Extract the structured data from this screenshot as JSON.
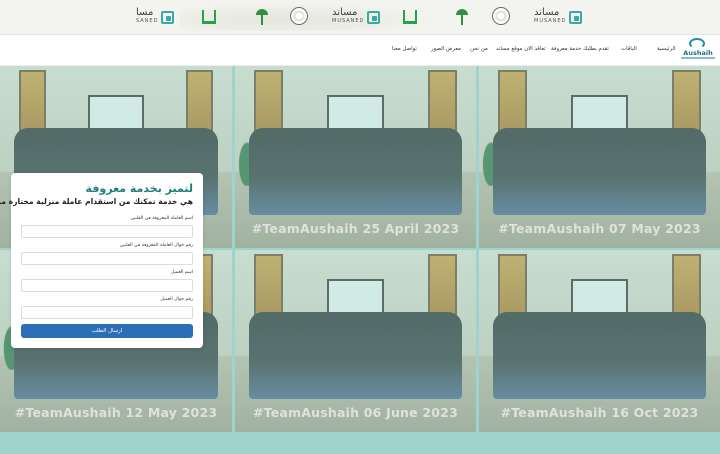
{
  "banner": {
    "logos": [
      {
        "type": "musaned",
        "arabic": "مساند",
        "latin": "MUSANED"
      },
      {
        "type": "seal"
      },
      {
        "type": "palm"
      },
      {
        "type": "absher",
        "label": "أبشر"
      },
      {
        "type": "musaned",
        "arabic": "مساند",
        "latin": "MUSANED"
      },
      {
        "type": "seal"
      },
      {
        "type": "palm"
      },
      {
        "type": "absher",
        "label": "أبشر"
      },
      {
        "type": "musaned",
        "arabic": "مسا",
        "latin": "SANED"
      }
    ]
  },
  "nav": {
    "brand_name": "Aushaih",
    "items": [
      "الرئيسية",
      "الباقات",
      "تقدم بطلبك خدمة معروفة",
      "تعاقد الان موقع مساند",
      "من نحن",
      "معرض الصور",
      "تواصل معنا"
    ]
  },
  "gallery": {
    "tiles": [
      {
        "caption": ""
      },
      {
        "caption": "#TeamAushaih 25 April 2023"
      },
      {
        "caption": "#TeamAushaih 07 May 2023"
      },
      {
        "caption": "#TeamAushaih 12 May 2023"
      },
      {
        "caption": "#TeamAushaih 06 June 2023"
      },
      {
        "caption": "#TeamAushaih 16 Oct 2023"
      }
    ]
  },
  "form": {
    "title": "لتميز بخدمة معروفة",
    "subtitle": "هي خدمة تمكنك من استقدام عاملة منزلية مختارة من قبلك",
    "fields": [
      {
        "label": "اسم العاملة المعروفة في الفلبين",
        "value": ""
      },
      {
        "label": "رقم جوال العاملة المعروفة في الفلبين",
        "value": ""
      },
      {
        "label": "اسم العميل",
        "value": ""
      },
      {
        "label": "رقم جوال العميل",
        "value": ""
      }
    ],
    "submit_label": "ارسال الطلب"
  },
  "colors": {
    "accent": "#1e7f7a",
    "button": "#2d6fb7",
    "overlay": "#9fd4cc"
  }
}
